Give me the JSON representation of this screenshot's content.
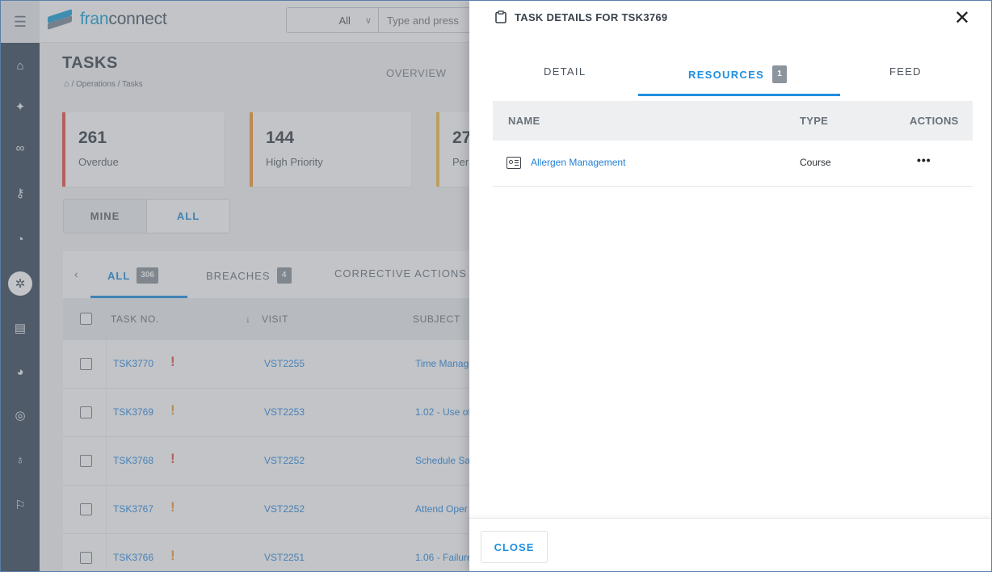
{
  "app": {
    "logo_prefix": "fran",
    "logo_suffix": "connect"
  },
  "colors": {
    "accent": "#1f8fe0",
    "rail": "#3a4a5c",
    "overdue": "#e8534a",
    "high_priority": "#f39c3c",
    "pending": "#f1c24a"
  },
  "search": {
    "scope": "All",
    "placeholder": "Type and press"
  },
  "page": {
    "title": "TASKS",
    "breadcrumb": "/ Operations / Tasks",
    "tab_overview": "OVERVIEW"
  },
  "cards": [
    {
      "value": "261",
      "label": "Overdue"
    },
    {
      "value": "144",
      "label": "High Priority"
    },
    {
      "value": "27",
      "label": "Per"
    }
  ],
  "scope_toggle": {
    "mine": "MINE",
    "all": "ALL"
  },
  "list_tabs": [
    {
      "label": "ALL",
      "count": "306"
    },
    {
      "label": "BREACHES",
      "count": "4"
    },
    {
      "label": "CORRECTIVE ACTIONS"
    }
  ],
  "table": {
    "headers": {
      "task_no": "TASK NO.",
      "visit": "VISIT",
      "subject": "SUBJECT",
      "sort_arrow": "↓"
    },
    "rows": [
      {
        "task": "TSK3770",
        "priority": "high",
        "visit": "VST2255",
        "subject": "Time Manag"
      },
      {
        "task": "TSK3769",
        "priority": "medium",
        "visit": "VST2253",
        "subject": "1.02 - Use of"
      },
      {
        "task": "TSK3768",
        "priority": "high",
        "visit": "VST2252",
        "subject": "Schedule Sa"
      },
      {
        "task": "TSK3767",
        "priority": "medium",
        "visit": "VST2252",
        "subject": "Attend Oper"
      },
      {
        "task": "TSK3766",
        "priority": "medium",
        "visit": "VST2251",
        "subject": "1.06 - Failure"
      }
    ]
  },
  "drawer": {
    "title": "TASK DETAILS FOR TSK3769",
    "tabs": [
      {
        "label": "DETAIL"
      },
      {
        "label": "RESOURCES",
        "count": "1"
      },
      {
        "label": "FEED"
      }
    ],
    "resources": {
      "headers": {
        "name": "NAME",
        "type": "TYPE",
        "actions": "ACTIONS"
      },
      "rows": [
        {
          "name": "Allergen Management",
          "type": "Course",
          "actions": "•••"
        }
      ]
    },
    "close_label": "CLOSE"
  }
}
